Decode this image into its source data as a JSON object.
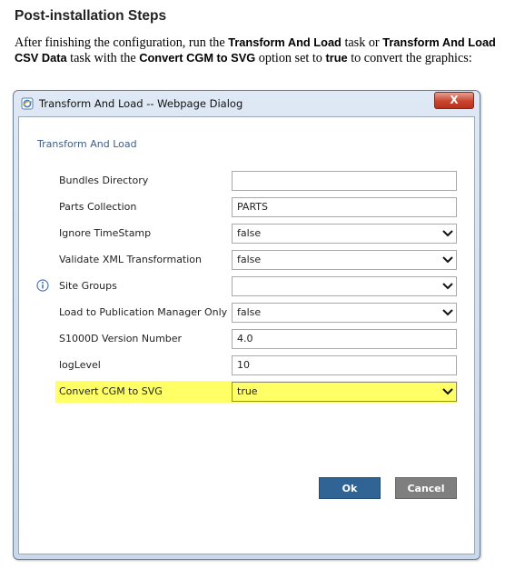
{
  "doc": {
    "heading": "Post-installation Steps",
    "para_1": "After finishing the configuration, run the ",
    "task_1": "Transform And Load",
    "para_2": " task or ",
    "task_2": "Transform And Load CSV Data",
    "para_3": " task with the ",
    "option": "Convert CGM to SVG",
    "para_4": " option set to ",
    "value": "true",
    "para_5": " to convert the graphics:"
  },
  "dialog": {
    "title": "Transform And Load -- Webpage Dialog",
    "close_label": "X",
    "form_title": "Transform And Load",
    "fields": [
      {
        "label": "Bundles Directory",
        "value": ""
      },
      {
        "label": "Parts Collection",
        "value": "PARTS"
      },
      {
        "label": "Ignore TimeStamp",
        "value": "false"
      },
      {
        "label": "Validate XML Transformation",
        "value": "false"
      },
      {
        "label": "Site Groups",
        "value": ""
      },
      {
        "label": "Load to Publication Manager Only",
        "value": "false"
      },
      {
        "label": "S1000D Version Number",
        "value": "4.0"
      },
      {
        "label": "logLevel",
        "value": "10"
      },
      {
        "label": "Convert CGM to SVG",
        "value": "true"
      }
    ],
    "ok_label": "Ok",
    "cancel_label": "Cancel"
  },
  "colors": {
    "highlight": "#ffff66",
    "ok_button": "#2f6494",
    "cancel_button": "#7f7f7f",
    "form_title": "#3b5e8c"
  },
  "icons": {
    "title": "ie-page-icon",
    "info": "info-icon",
    "dropdown": "chevron-down-icon",
    "close": "close-icon"
  }
}
